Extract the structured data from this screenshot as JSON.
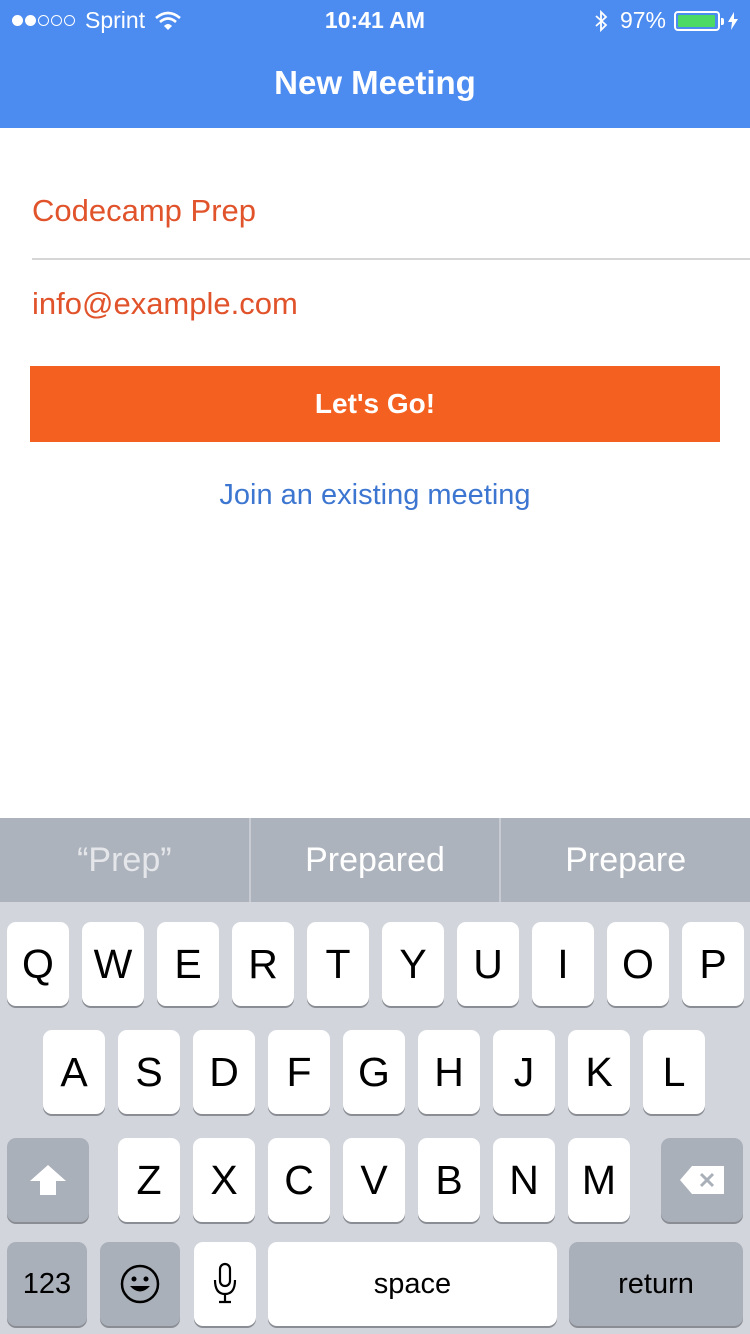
{
  "status_bar": {
    "carrier": "Sprint",
    "time": "10:41 AM",
    "battery_percent": "97%",
    "battery_level": 0.97,
    "signal_bars_filled": 2,
    "signal_bars_total": 5
  },
  "header": {
    "title": "New Meeting",
    "background_color": "#4c8bf0"
  },
  "form": {
    "meeting_name_value": "Codecamp Prep",
    "email_value": "info@example.com",
    "text_color": "#e0532b",
    "submit_label": "Let's Go!",
    "submit_color": "#f4601f",
    "join_link": "Join an existing meeting"
  },
  "keyboard": {
    "suggestions": [
      "“Prep”",
      "Prepared",
      "Prepare"
    ],
    "rows": [
      [
        "Q",
        "W",
        "E",
        "R",
        "T",
        "Y",
        "U",
        "I",
        "O",
        "P"
      ],
      [
        "A",
        "S",
        "D",
        "F",
        "G",
        "H",
        "J",
        "K",
        "L"
      ],
      [
        "Z",
        "X",
        "C",
        "V",
        "B",
        "N",
        "M"
      ]
    ],
    "numbers_label": "123",
    "space_label": "space",
    "return_label": "return"
  }
}
